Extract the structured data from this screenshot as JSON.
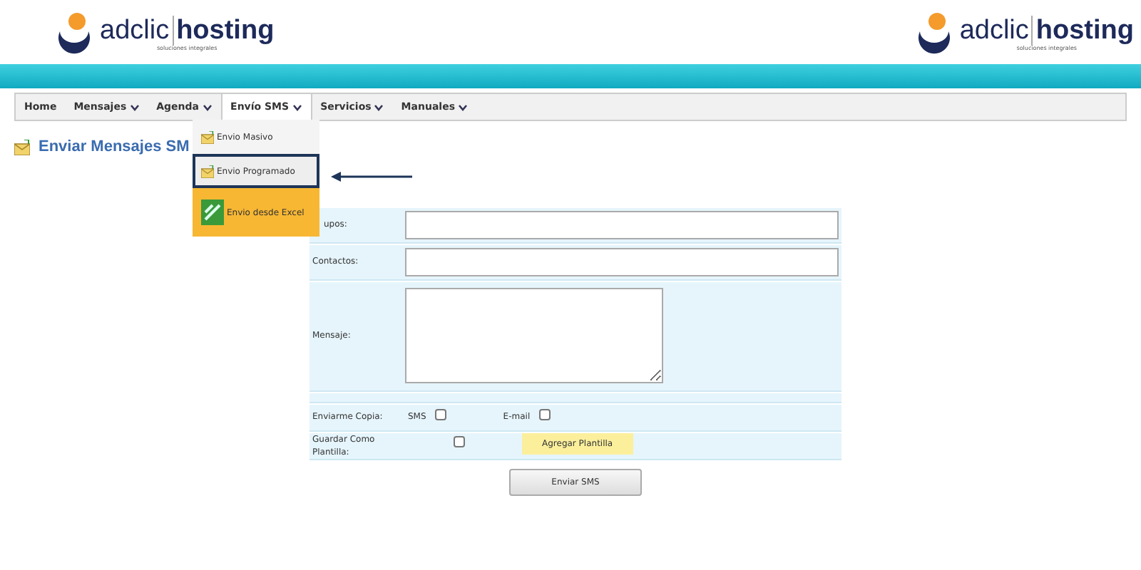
{
  "header": {
    "logo_left": {
      "name": "adclic",
      "name2": "hosting",
      "tagline": "soluciones integrales"
    },
    "logo_right": {
      "name": "adclic",
      "name2": "hosting",
      "tagline": "soluciones integrales"
    }
  },
  "nav": [
    {
      "label": "Home",
      "dropdown": false,
      "selected": false
    },
    {
      "label": "Mensajes",
      "dropdown": true,
      "selected": false
    },
    {
      "label": "Agenda",
      "dropdown": true,
      "selected": false
    },
    {
      "label": "Envío SMS",
      "dropdown": true,
      "selected": true
    },
    {
      "label": "Servicios",
      "dropdown": true,
      "selected": false
    },
    {
      "label": "Manuales",
      "dropdown": true,
      "selected": false
    }
  ],
  "dropdown": [
    {
      "label": "Envio Masivo",
      "kind": "plain",
      "selected": false
    },
    {
      "label": "Envio Programado",
      "kind": "plain",
      "selected": true
    },
    {
      "label": "Envio desde Excel",
      "kind": "excel",
      "selected": false
    }
  ],
  "page_title": "Enviar Mensajes SM",
  "form": {
    "rows": [
      {
        "kind": "input",
        "label": "upos:"
      },
      {
        "kind": "input",
        "label": "Contactos:"
      },
      {
        "kind": "textarea",
        "label": "Mensaje:"
      },
      {
        "kind": "copy",
        "label": "Enviarme Copia:",
        "options": [
          {
            "label": "SMS",
            "checked": false
          },
          {
            "label": "E-mail",
            "checked": false
          }
        ]
      },
      {
        "kind": "template",
        "label": "Guardar Como Plantilla:",
        "checked": false,
        "button": "Agregar Plantilla"
      }
    ],
    "submit": "Enviar SMS"
  }
}
